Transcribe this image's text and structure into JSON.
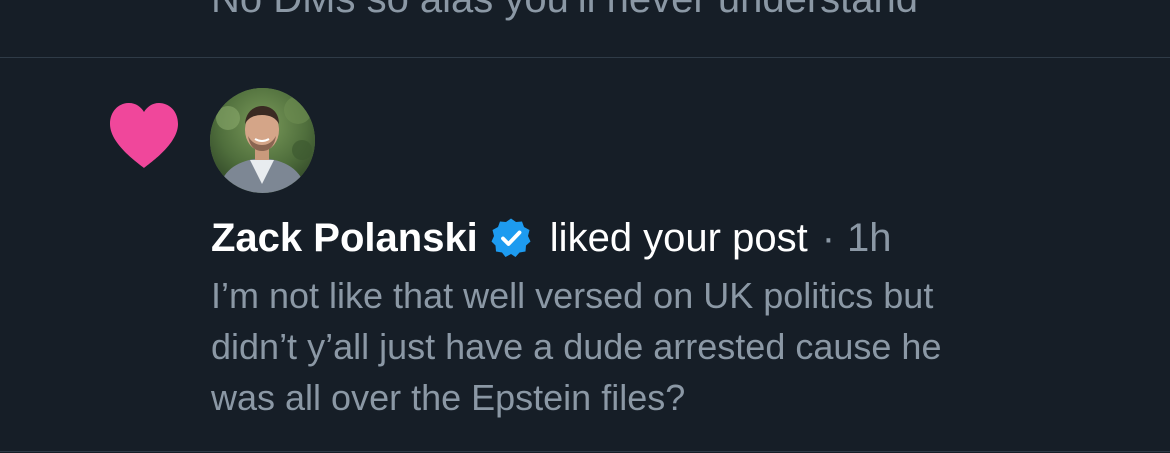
{
  "previous_item": {
    "text": "No DMs so alas you’ll never understand"
  },
  "notification": {
    "type_icon": "heart-icon",
    "author": {
      "name": "Zack Polanski",
      "verified": true,
      "avatar_icon": "avatar"
    },
    "action": "liked your post",
    "separator": "·",
    "time": "1h",
    "post_excerpt": "I’m not like that well versed on UK politics but\ndidn’t y’all just have a dude arrested cause he\nwas all over the Epstein files?"
  },
  "colors": {
    "background": "#161e27",
    "heart": "#f0479b",
    "verified": "#1d9bf0",
    "primary_text": "#ffffff",
    "secondary_text": "#8b98a5",
    "divider": "#2f3b47"
  }
}
